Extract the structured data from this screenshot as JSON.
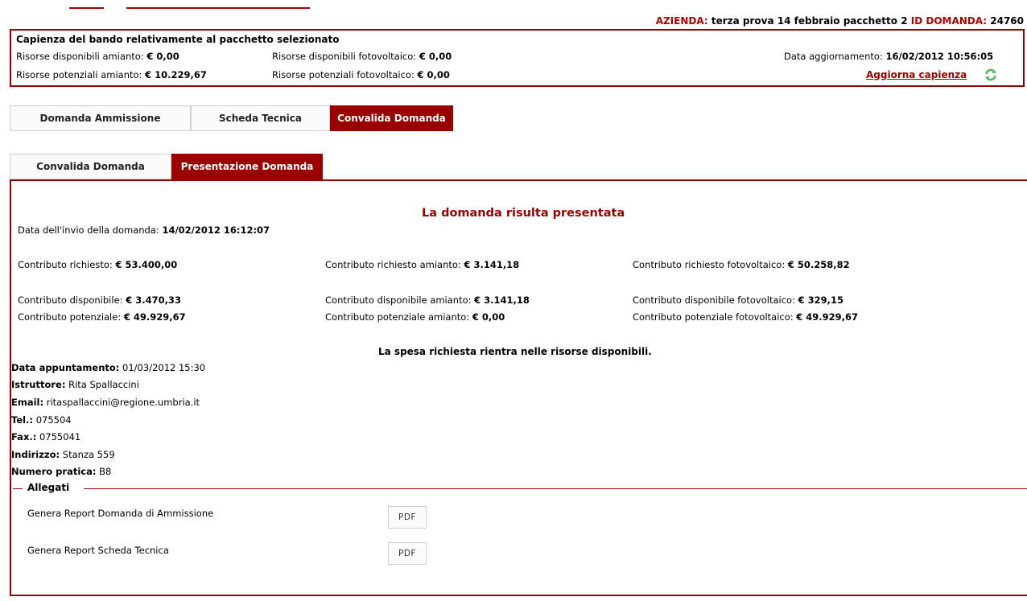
{
  "header": {
    "azienda_label": "AZIENDA:",
    "azienda_value": "terza prova 14 febbraio pacchetto 2",
    "id_label": "ID DOMANDA:",
    "id_value": "24760"
  },
  "capacity": {
    "title": "Capienza del bando relativamente al pacchetto selezionato",
    "amianto_disp_label": "Risorse disponibili amianto:",
    "amianto_disp_value": "€ 0,00",
    "amianto_pot_label": "Risorse potenziali amianto:",
    "amianto_pot_value": "€ 10.229,67",
    "foto_disp_label": "Risorse disponibili fotovoltaico:",
    "foto_disp_value": "€ 0,00",
    "foto_pot_label": "Risorse potenziali fotovoltaico:",
    "foto_pot_value": "€ 0,00",
    "update_label": "Data aggiornamento:",
    "update_value": "16/02/2012 10:56:05",
    "refresh_link": "Aggiorna capienza",
    "refresh_icon": "refresh-icon"
  },
  "main_tabs": [
    "Domanda Ammissione",
    "Scheda Tecnica",
    "Convalida Domanda"
  ],
  "sub_tabs": [
    "Convalida Domanda",
    "Presentazione Domanda"
  ],
  "panel": {
    "status_title": "La domanda risulta presentata",
    "invio_label": "Data dell'invio della domanda:",
    "invio_value": "14/02/2012 16:12:07",
    "contributi": {
      "richiesto_label": "Contributo richiesto:",
      "richiesto_value": "€ 53.400,00",
      "richiesto_am_label": "Contributo richiesto amianto:",
      "richiesto_am_value": "€ 3.141,18",
      "richiesto_fv_label": "Contributo richiesto fotovoltaico:",
      "richiesto_fv_value": "€ 50.258,82",
      "disp_label": "Contributo disponibile:",
      "disp_value": "€ 3.470,33",
      "disp_am_label": "Contributo disponibile amianto:",
      "disp_am_value": "€ 3.141,18",
      "disp_fv_label": "Contributo disponibile fotovoltaico:",
      "disp_fv_value": "€ 329,15",
      "pot_label": "Contributo potenziale:",
      "pot_value": "€ 49.929,67",
      "pot_am_label": "Contributo potenziale amianto:",
      "pot_am_value": "€ 0,00",
      "pot_fv_label": "Contributo potenziale fotovoltaico:",
      "pot_fv_value": "€ 49.929,67"
    },
    "spesa_msg": "La spesa richiesta rientra nelle risorse disponibili.",
    "appuntamento": {
      "data_label": "Data appuntamento:",
      "data_value": "01/03/2012 15:30",
      "istruttore_label": "Istruttore:",
      "istruttore_value": "Rita Spallaccini",
      "email_label": "Email:",
      "email_value": "ritaspallaccini@regione.umbria.it",
      "tel_label": "Tel.:",
      "tel_value": "075504",
      "fax_label": "Fax.:",
      "fax_value": "0755041",
      "indirizzo_label": "Indirizzo:",
      "indirizzo_value": "Stanza 559",
      "pratica_label": "Numero pratica:",
      "pratica_value": "B8"
    },
    "allegati": {
      "legend": "Allegati",
      "items": [
        {
          "label": "Genera Report Domanda di Ammissione",
          "button": "PDF"
        },
        {
          "label": "Genera Report Scheda Tecnica",
          "button": "PDF"
        }
      ]
    }
  },
  "colors": {
    "accent": "#9b0000",
    "header_label": "#b00000",
    "refresh_icon": "#5cb85c"
  }
}
